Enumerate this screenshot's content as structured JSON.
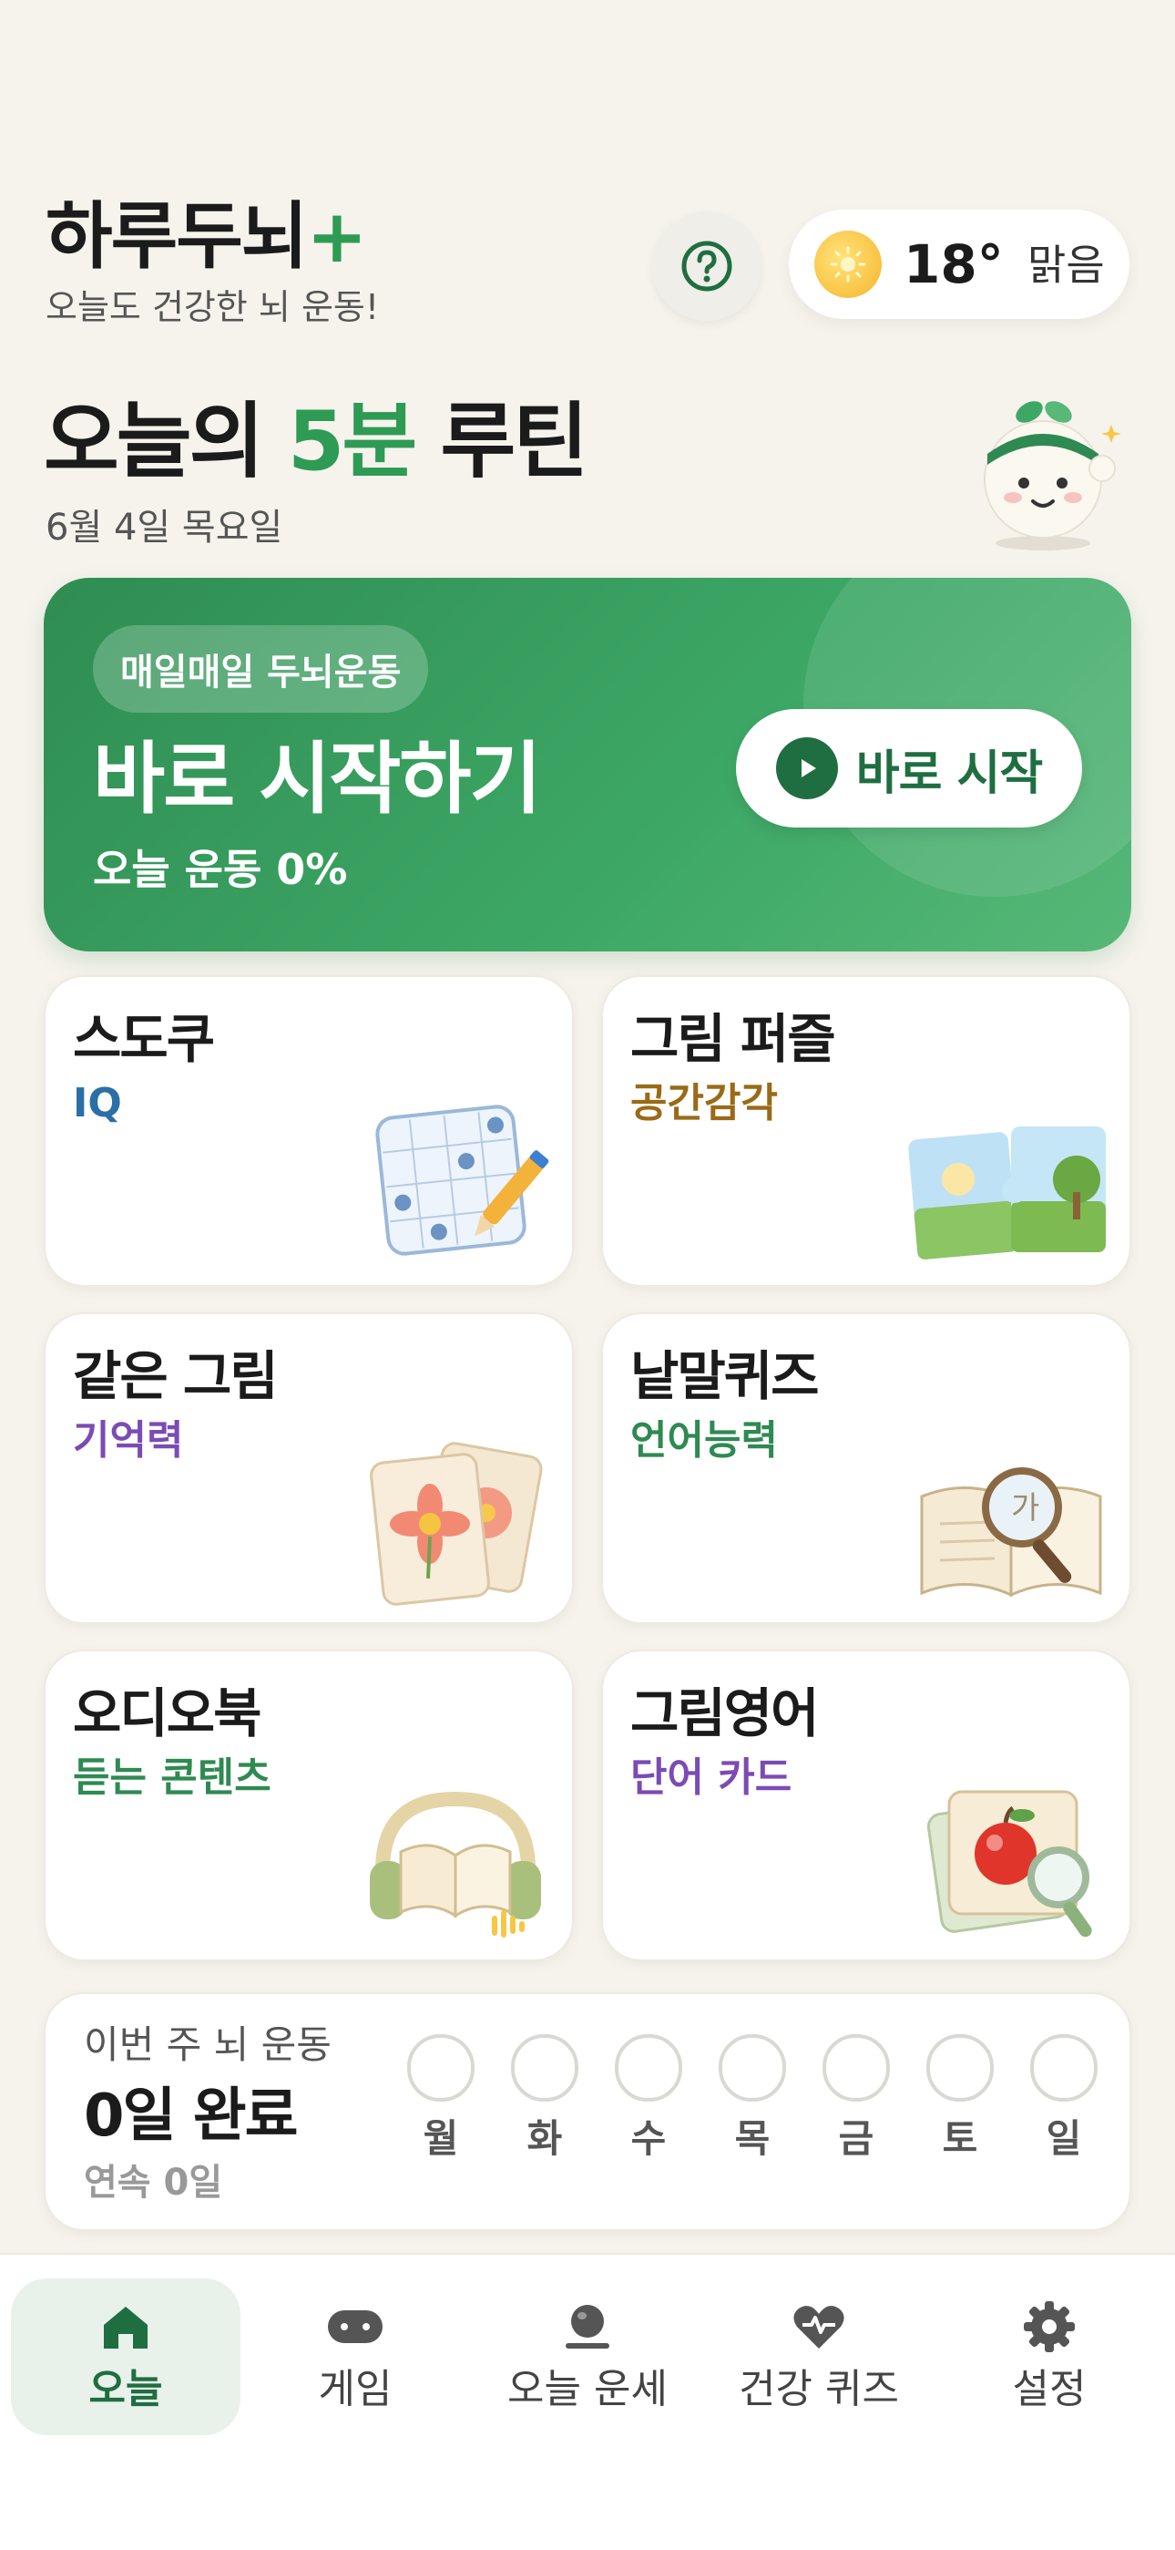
{
  "header": {
    "app_name": "하루두뇌",
    "app_plus": "+",
    "tagline": "오늘도 건강한 뇌 운동!",
    "help_icon": "question-circle-icon",
    "weather": {
      "icon": "sun-icon",
      "temperature": "18°",
      "condition": "맑음"
    }
  },
  "routine": {
    "title_prefix": "오늘의 ",
    "title_accent": "5분",
    "title_suffix": " 루틴",
    "date": "6월 4일 목요일"
  },
  "hero": {
    "chip": "매일매일 두뇌운동",
    "title": "바로 시작하기",
    "progress": "오늘 운동 0%",
    "start_button": "바로 시작"
  },
  "games": [
    {
      "title": "스도쿠",
      "sub": "IQ",
      "sub_color": "#2a6fa8",
      "icon": "sudoku-grid-icon"
    },
    {
      "title": "그림 퍼즐",
      "sub": "공간감각",
      "sub_color": "#9a6a17",
      "icon": "jigsaw-puzzle-icon"
    },
    {
      "title": "같은 그림",
      "sub": "기억력",
      "sub_color": "#7b4bb5",
      "icon": "flower-cards-icon"
    },
    {
      "title": "낱말퀴즈",
      "sub": "언어능력",
      "sub_color": "#2e8a52",
      "icon": "book-magnifier-icon"
    },
    {
      "title": "오디오북",
      "sub": "듣는 콘텐츠",
      "sub_color": "#2e8a52",
      "icon": "audiobook-headphones-icon"
    },
    {
      "title": "그림영어",
      "sub": "단어 카드",
      "sub_color": "#7b4bb5",
      "icon": "apple-flashcard-icon"
    }
  ],
  "week": {
    "label": "이번 주 뇌 운동",
    "done": "0일 완료",
    "streak": "연속 0일",
    "days": [
      "월",
      "화",
      "수",
      "목",
      "금",
      "토",
      "일"
    ]
  },
  "nav": [
    {
      "label": "오늘",
      "icon": "home-icon",
      "active": true
    },
    {
      "label": "게임",
      "icon": "gamepad-icon",
      "active": false
    },
    {
      "label": "오늘 운세",
      "icon": "fortune-ball-icon",
      "active": false
    },
    {
      "label": "건강 퀴즈",
      "icon": "heart-pulse-icon",
      "active": false
    },
    {
      "label": "설정",
      "icon": "gear-icon",
      "active": false
    }
  ],
  "colors": {
    "accent": "#2e9b55",
    "accent_dark": "#1f6e41",
    "background": "#f6f3ec"
  }
}
